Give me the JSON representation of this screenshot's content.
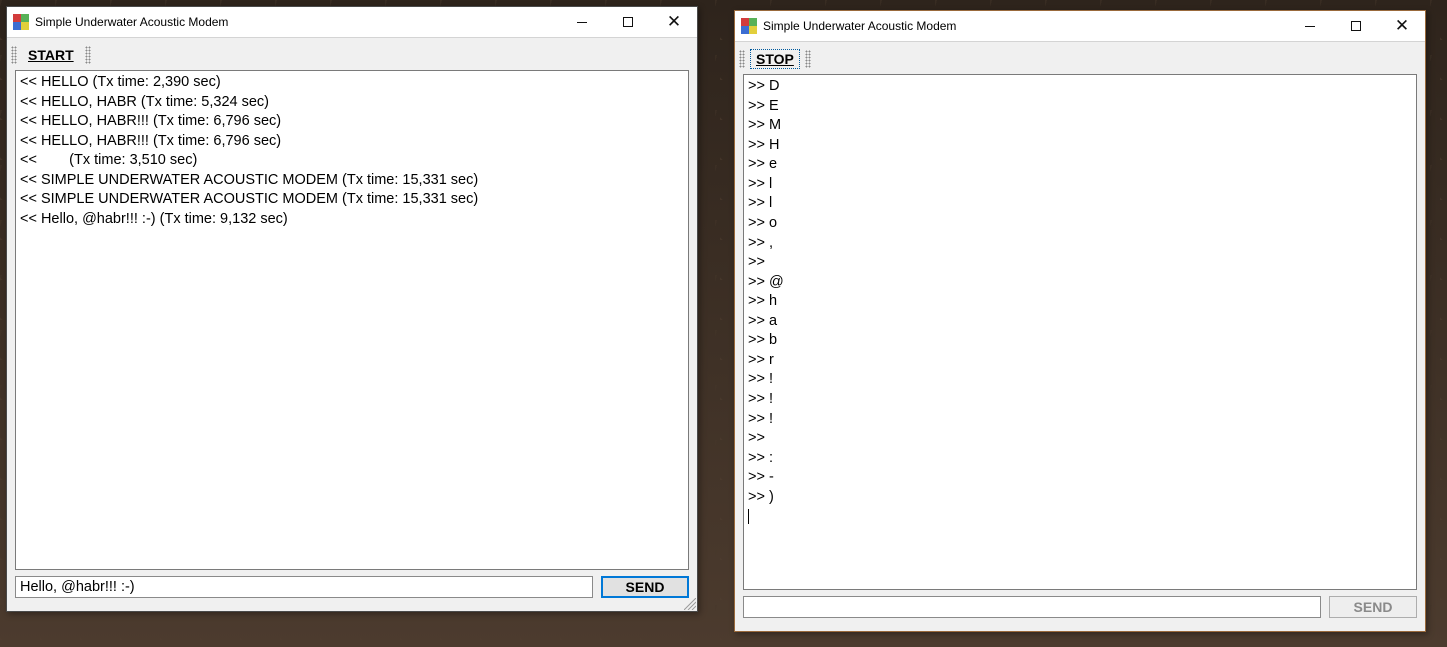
{
  "app_title": "Simple Underwater Acoustic Modem",
  "left": {
    "mode_button": "START",
    "log_lines": [
      "<< HELLO (Tx time: 2,390 sec)",
      "<< HELLO, HABR (Tx time: 5,324 sec)",
      "<< HELLO, HABR!!! (Tx time: 6,796 sec)",
      "<< HELLO, HABR!!! (Tx time: 6,796 sec)",
      "<<        (Tx time: 3,510 sec)",
      "<< SIMPLE UNDERWATER ACOUSTIC MODEM (Tx time: 15,331 sec)",
      "<< SIMPLE UNDERWATER ACOUSTIC MODEM (Tx time: 15,331 sec)",
      "<< Hello, @habr!!! :-) (Tx time: 9,132 sec)"
    ],
    "input_value": "Hello, @habr!!! :-)",
    "send_label": "SEND"
  },
  "right": {
    "mode_button": "STOP",
    "log_lines": [
      ">> D",
      ">> E",
      ">> M",
      ">> H",
      ">> e",
      ">> l",
      ">> l",
      ">> o",
      ">> ,",
      ">> ",
      ">> @",
      ">> h",
      ">> a",
      ">> b",
      ">> r",
      ">> !",
      ">> !",
      ">> !",
      ">> ",
      ">> :",
      ">> -",
      ">> )"
    ],
    "input_value": "",
    "send_label": "SEND"
  }
}
